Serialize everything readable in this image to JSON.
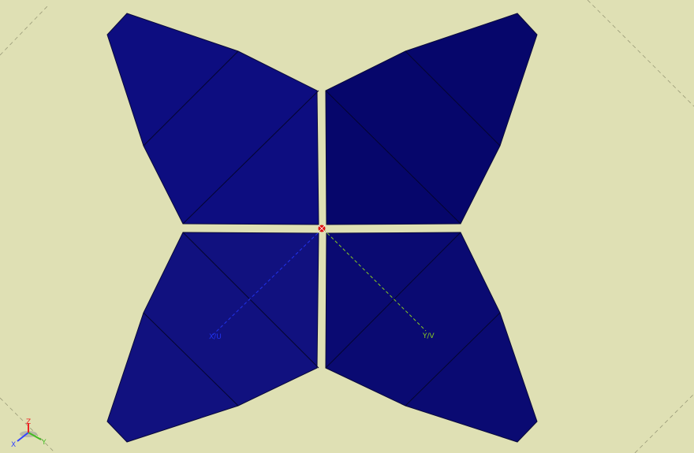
{
  "viewport": {
    "background": "#dfe0b4",
    "reference_line_color": "#8a8a6a"
  },
  "quadrants": [
    {
      "name": "upper-left",
      "color": "#0d0d80"
    },
    {
      "name": "upper-right",
      "color": "#06066b"
    },
    {
      "name": "lower-left",
      "color": "#11117f"
    },
    {
      "name": "lower-right",
      "color": "#0a0a72"
    }
  ],
  "axes": {
    "origin_marker_color": "#dd1111",
    "x_axis": {
      "label": "X/U",
      "color": "#2233ee"
    },
    "y_axis": {
      "label": "Y/V",
      "color": "#88cc22"
    }
  },
  "triad": {
    "x_label": "X",
    "y_label": "Y",
    "z_label": "Z",
    "x_color": "#3344ff",
    "y_color": "#44bb22",
    "z_color": "#ee2222"
  }
}
